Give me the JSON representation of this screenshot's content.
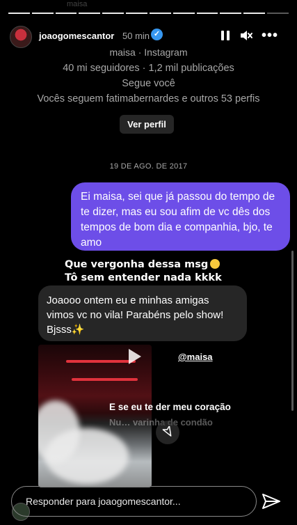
{
  "story": {
    "faded_top": "maisa",
    "username": "joaogomescantor",
    "time": "50 min",
    "segments": 12
  },
  "profile": {
    "line1": "maisa · Instagram",
    "line2": "40 mi seguidores · 1,2 mil publicações",
    "line3": "Segue você",
    "line4": "Vocês seguem fatimabernardes e outros 53 perfis",
    "button": "Ver perfil"
  },
  "thread": {
    "date": "19 DE AGO. DE 2017",
    "sent_message": "Ei maisa, sei que já passou do tempo de te dizer, mas eu sou afim de vc dês dos tempos de bom dia e companhia, bjo, te amo",
    "caption_line1": "Que vergonha dessa msg",
    "caption_line2": "Tô sem entender nada kkkk",
    "received_message": "Joaooo ontem eu e minhas amigas vimos vc no vila! Parabéns pelo show! Bjsss",
    "received_emoji": "✨"
  },
  "video_overlay": {
    "mention": "@maisa",
    "lyric_line1": "E se eu te der meu coração",
    "lyric_line2": "Nu… varinha de condão"
  },
  "reply": {
    "placeholder": "Responder para joaogomescantor..."
  },
  "colors": {
    "sent_bubble": "#6d4ee8",
    "received_bubble": "#262626",
    "verified": "#3797f0"
  }
}
